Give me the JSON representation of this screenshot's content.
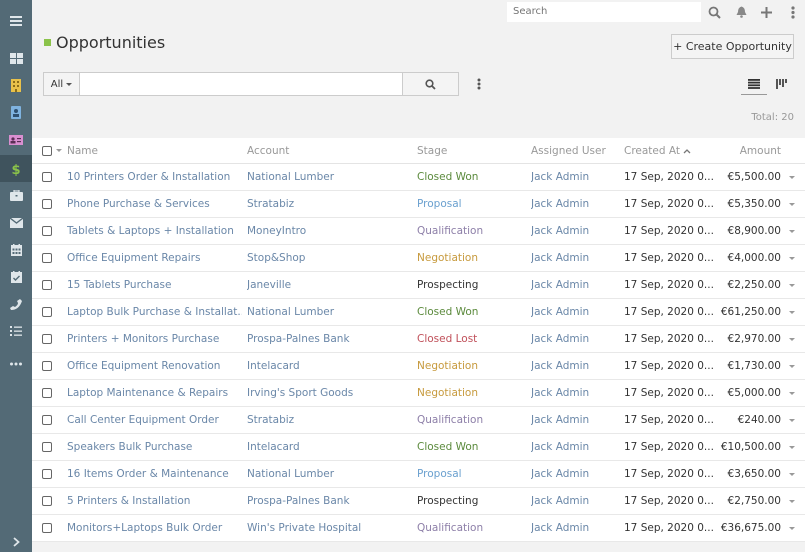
{
  "sidebar": {
    "items": [
      {
        "name": "menu-toggle",
        "icon": "hamburger-icon"
      },
      {
        "name": "dashboard",
        "icon": "dashboard-icon"
      },
      {
        "name": "accounts",
        "icon": "building-icon",
        "color": "#e8c14a"
      },
      {
        "name": "contacts",
        "icon": "contact-badge-icon",
        "color": "#7fb3e0"
      },
      {
        "name": "leads",
        "icon": "id-card-icon",
        "color": "#d98fd0"
      },
      {
        "name": "opportunities",
        "icon": "dollar-icon",
        "color": "#8bc34a",
        "active": true
      },
      {
        "name": "cases",
        "icon": "briefcase-icon"
      },
      {
        "name": "emails",
        "icon": "envelope-icon"
      },
      {
        "name": "calendar",
        "icon": "calendar-icon"
      },
      {
        "name": "meetings",
        "icon": "calendar-check-icon"
      },
      {
        "name": "calls",
        "icon": "phone-icon"
      },
      {
        "name": "tasks",
        "icon": "tasks-icon"
      },
      {
        "name": "more",
        "icon": "ellipsis-icon"
      }
    ],
    "expand_icon": "chevron-right-icon"
  },
  "topbar": {
    "search_placeholder": "Search"
  },
  "page": {
    "title": "Opportunities",
    "title_color": "#8bc34a",
    "create_button": "+ Create Opportunity",
    "filter_label": "All",
    "total": "Total: 20"
  },
  "table": {
    "headers": {
      "name": "Name",
      "account": "Account",
      "stage": "Stage",
      "assigned_user": "Assigned User",
      "created_at": "Created At",
      "amount": "Amount"
    },
    "stage_colors": {
      "Closed Won": "#5b8a3c",
      "Proposal": "#6aa0cf",
      "Qualification": "#8d7fa8",
      "Negotiation": "#c79a3d",
      "Prospecting": "#333333",
      "Closed Lost": "#c0505a"
    },
    "rows": [
      {
        "name": "10 Printers Order & Installation",
        "account": "National Lumber",
        "stage": "Closed Won",
        "user": "Jack Admin",
        "created": "17 Sep, 2020 0...",
        "amount": "€5,500.00"
      },
      {
        "name": "Phone Purchase & Services",
        "account": "Stratabiz",
        "stage": "Proposal",
        "user": "Jack Admin",
        "created": "17 Sep, 2020 0...",
        "amount": "€5,350.00"
      },
      {
        "name": "Tablets & Laptops + Installation",
        "account": "MoneyIntro",
        "stage": "Qualification",
        "user": "Jack Admin",
        "created": "17 Sep, 2020 0...",
        "amount": "€8,900.00"
      },
      {
        "name": "Office Equipment Repairs",
        "account": "Stop&Shop",
        "stage": "Negotiation",
        "user": "Jack Admin",
        "created": "17 Sep, 2020 0...",
        "amount": "€4,000.00"
      },
      {
        "name": "15 Tablets Purchase",
        "account": "Janeville",
        "stage": "Prospecting",
        "user": "Jack Admin",
        "created": "17 Sep, 2020 0...",
        "amount": "€2,250.00"
      },
      {
        "name": "Laptop Bulk Purchase & Installat...",
        "account": "National Lumber",
        "stage": "Closed Won",
        "user": "Jack Admin",
        "created": "17 Sep, 2020 0...",
        "amount": "€61,250.00"
      },
      {
        "name": "Printers + Monitors Purchase",
        "account": "Prospa-Palnes Bank",
        "stage": "Closed Lost",
        "user": "Jack Admin",
        "created": "17 Sep, 2020 0...",
        "amount": "€2,970.00"
      },
      {
        "name": "Office Equipment Renovation",
        "account": "Intelacard",
        "stage": "Negotiation",
        "user": "Jack Admin",
        "created": "17 Sep, 2020 0...",
        "amount": "€1,730.00"
      },
      {
        "name": "Laptop Maintenance & Repairs",
        "account": "Irving's Sport Goods",
        "stage": "Negotiation",
        "user": "Jack Admin",
        "created": "17 Sep, 2020 0...",
        "amount": "€5,000.00"
      },
      {
        "name": "Call Center Equipment Order",
        "account": "Stratabiz",
        "stage": "Qualification",
        "user": "Jack Admin",
        "created": "17 Sep, 2020 0...",
        "amount": "€240.00"
      },
      {
        "name": "Speakers Bulk Purchase",
        "account": "Intelacard",
        "stage": "Closed Won",
        "user": "Jack Admin",
        "created": "17 Sep, 2020 0...",
        "amount": "€10,500.00"
      },
      {
        "name": "16 Items Order & Maintenance",
        "account": "National Lumber",
        "stage": "Proposal",
        "user": "Jack Admin",
        "created": "17 Sep, 2020 0...",
        "amount": "€3,650.00"
      },
      {
        "name": "5 Printers & Installation",
        "account": "Prospa-Palnes Bank",
        "stage": "Prospecting",
        "user": "Jack Admin",
        "created": "17 Sep, 2020 0...",
        "amount": "€2,750.00"
      },
      {
        "name": "Monitors+Laptops Bulk Order",
        "account": "Win's Private Hospital",
        "stage": "Qualification",
        "user": "Jack Admin",
        "created": "17 Sep, 2020 0...",
        "amount": "€36,675.00"
      }
    ]
  }
}
